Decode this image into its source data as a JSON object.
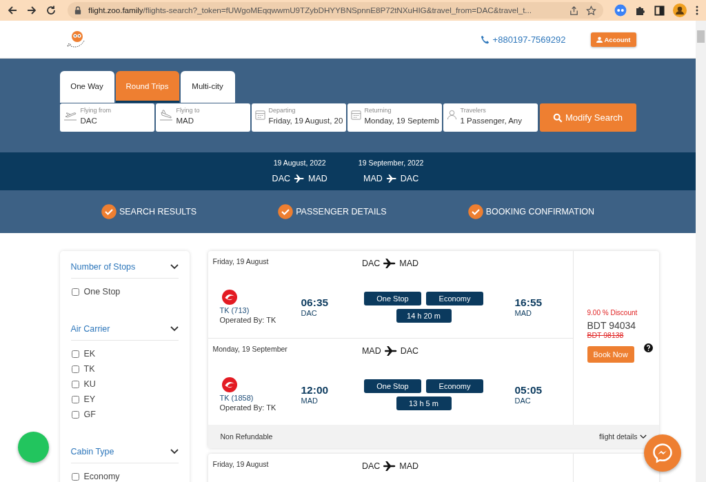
{
  "browser": {
    "url_host": "flight.zoo.family",
    "url_path": "/flights-search?_token=fUWgoMEqqwwmU9TZybDHYYBNSpnnE8P72tNXuHIG&travel_from=DAC&travel_t..."
  },
  "header": {
    "phone": "+880197-7569292",
    "account_button": "Account"
  },
  "tabs": [
    {
      "label": "One Way",
      "selected": false
    },
    {
      "label": "Round Trips",
      "selected": true
    },
    {
      "label": "Multi-city",
      "selected": false
    }
  ],
  "fields": [
    {
      "kind": "takeoff",
      "label": "Flying from",
      "value": "DAC"
    },
    {
      "kind": "landing",
      "label": "Flying to",
      "value": "MAD"
    },
    {
      "kind": "calendar",
      "label": "Departing",
      "value": "Friday, 19 August, 20"
    },
    {
      "kind": "calendar",
      "label": "Returning",
      "value": "Monday, 19 Septemb"
    },
    {
      "kind": "person",
      "label": "Travelers",
      "value": "1 Passenger, Any"
    }
  ],
  "search_button": "Modify Search",
  "trip_summary": [
    {
      "date": "19 August, 2022",
      "from": "DAC",
      "to": "MAD"
    },
    {
      "date": "19 September, 2022",
      "from": "MAD",
      "to": "DAC"
    }
  ],
  "steps": [
    {
      "label": "SEARCH RESULTS",
      "done": true
    },
    {
      "label": "PASSENGER DETAILS",
      "done": true
    },
    {
      "label": "BOOKING CONFIRMATION",
      "done": true
    }
  ],
  "filters": [
    {
      "title": "Number of Stops",
      "expanded": true,
      "options": [
        {
          "label": "One Stop",
          "checked": false
        }
      ]
    },
    {
      "title": "Air Carrier",
      "expanded": true,
      "options": [
        {
          "label": "EK",
          "checked": false
        },
        {
          "label": "TK",
          "checked": false
        },
        {
          "label": "KU",
          "checked": false
        },
        {
          "label": "EY",
          "checked": false
        },
        {
          "label": "GF",
          "checked": false
        }
      ]
    },
    {
      "title": "Cabin Type",
      "expanded": true,
      "options": [
        {
          "label": "Economy",
          "checked": false
        }
      ]
    }
  ],
  "results": [
    {
      "segments": [
        {
          "date": "Friday, 19 August",
          "from": "DAC",
          "to": "MAD",
          "flight": "TK (713)",
          "operated_by": "Operated By: TK",
          "depart_time": "06:35",
          "depart_airport": "DAC",
          "stops": "One Stop",
          "cabin": "Economy",
          "duration": "14 h 20 m",
          "arrive_time": "16:55",
          "arrive_airport": "MAD"
        },
        {
          "date": "Monday, 19 September",
          "from": "MAD",
          "to": "DAC",
          "flight": "TK (1858)",
          "operated_by": "Operated By: TK",
          "depart_time": "12:00",
          "depart_airport": "MAD",
          "stops": "One Stop",
          "cabin": "Economy",
          "duration": "13 h 5 m",
          "arrive_time": "05:05",
          "arrive_airport": "DAC"
        }
      ],
      "discount": "9.00 % Discount",
      "price": "BDT 94034",
      "old_price": "BDT 98138",
      "book_button": "Book Now",
      "refund": "Non Refundable",
      "details_link": "flight details"
    },
    {
      "segments": [
        {
          "date": "Friday, 19 August",
          "from": "DAC",
          "to": "MAD"
        }
      ]
    }
  ]
}
